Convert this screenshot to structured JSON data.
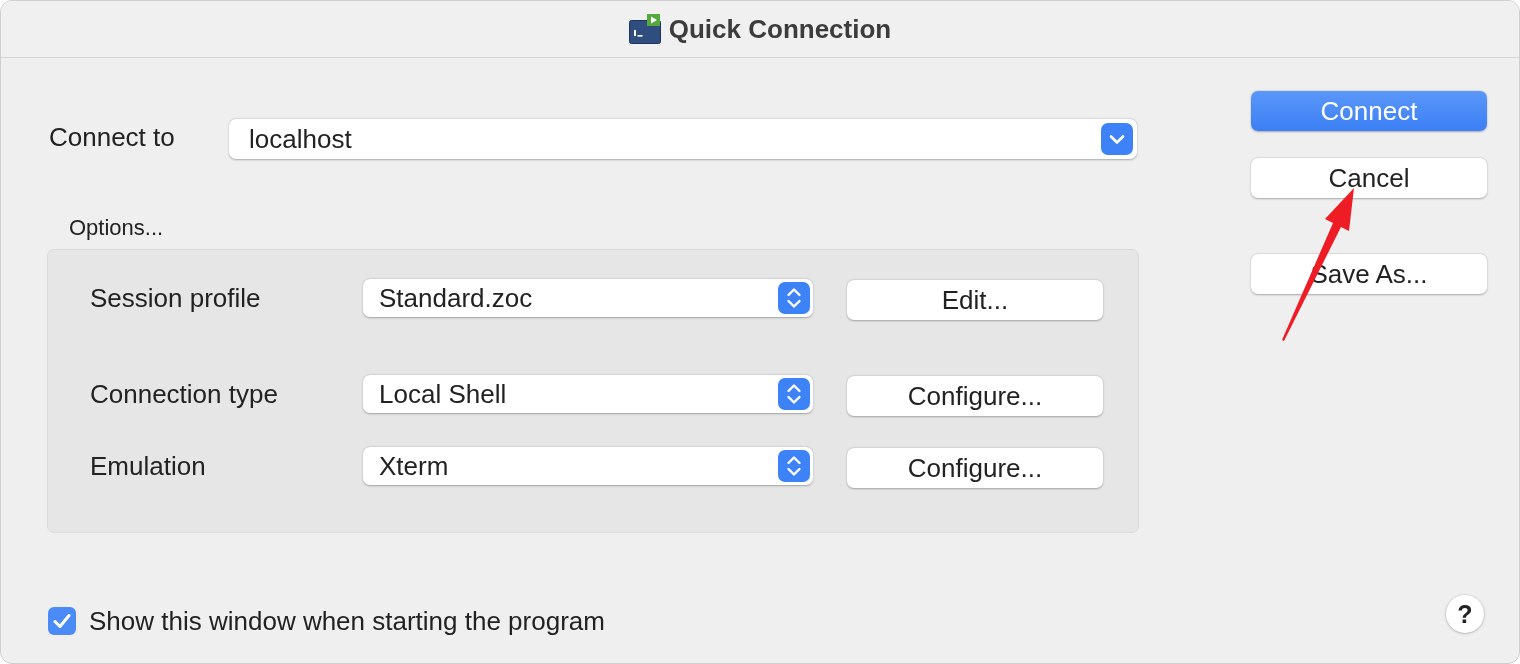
{
  "window": {
    "title": "Quick Connection"
  },
  "connect_to": {
    "label": "Connect to",
    "value": "localhost"
  },
  "options": {
    "label": "Options...",
    "rows": [
      {
        "label": "Session profile",
        "value": "Standard.zoc",
        "button": "Edit..."
      },
      {
        "label": "Connection type",
        "value": "Local Shell",
        "button": "Configure..."
      },
      {
        "label": "Emulation",
        "value": "Xterm",
        "button": "Configure..."
      }
    ]
  },
  "buttons": [
    {
      "label": "Connect",
      "kind": "default"
    },
    {
      "label": "Cancel",
      "kind": "normal"
    },
    {
      "label": "Save As...",
      "kind": "normal"
    }
  ],
  "show_on_start": {
    "label": "Show this window when starting the program",
    "checked": true
  },
  "help": {
    "label": "?"
  }
}
